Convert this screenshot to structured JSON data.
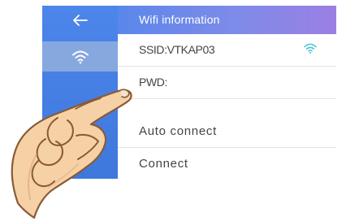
{
  "header": {
    "title": "Wifi information"
  },
  "sidebar": {
    "back_icon": "back-arrow-icon",
    "wifi_icon": "wifi-icon"
  },
  "rows": [
    {
      "label": "SSID:VTKAP03",
      "icon": "wifi-icon"
    },
    {
      "label": "PWD:"
    },
    {
      "label": "Auto connect"
    },
    {
      "label": "Connect"
    }
  ],
  "colors": {
    "sidebar": "#4a82e8",
    "sidebar_selected": "#87a7df",
    "header_start": "#5a87ea",
    "header_end": "#9b7fe3",
    "row_wifi": "#3ec6d1"
  }
}
